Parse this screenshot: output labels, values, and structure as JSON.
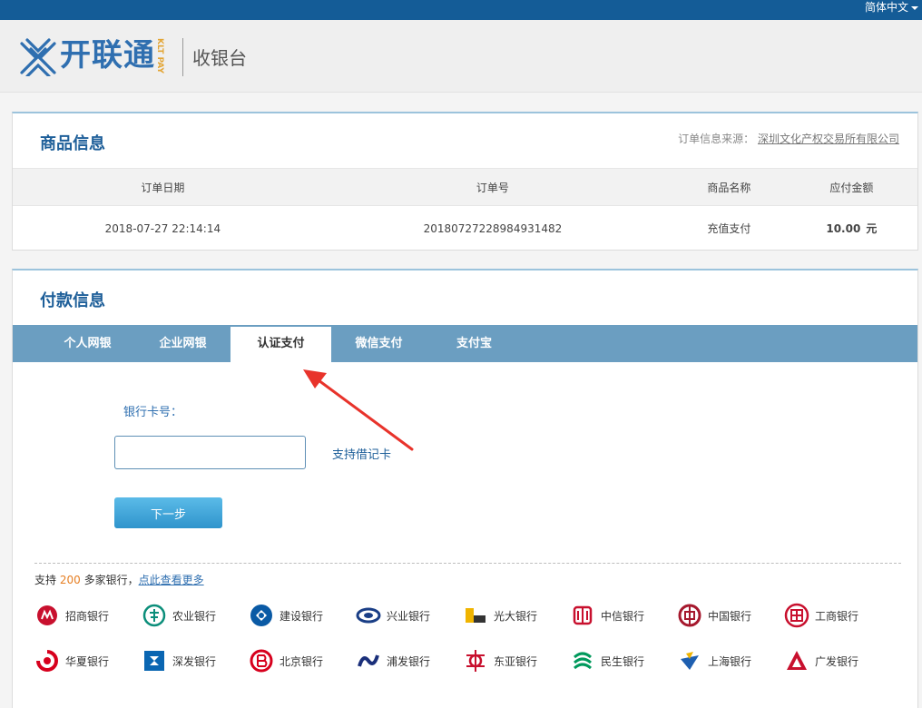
{
  "topbar": {
    "language": "简体中文"
  },
  "header": {
    "logo_text": "开联通",
    "logo_sub": "KLT PAY",
    "title": "收银台"
  },
  "goods": {
    "title": "商品信息",
    "source_label": "订单信息来源：",
    "source_name": "深圳文化产权交易所有限公司",
    "columns": [
      "订单日期",
      "订单号",
      "商品名称",
      "应付金额"
    ],
    "row": {
      "date": "2018-07-27 22:14:14",
      "order_no": "20180727228984931482",
      "product": "充值支付",
      "amount": "10.00",
      "unit": "元"
    }
  },
  "payment": {
    "title": "付款信息",
    "tabs": [
      "个人网银",
      "企业网银",
      "认证支付",
      "微信支付",
      "支付宝"
    ],
    "active_tab": "认证支付",
    "card_label": "银行卡号：",
    "card_value": "",
    "support_text": "支持借记卡",
    "next_button": "下一步",
    "bank_note_prefix": "支持",
    "bank_count": "200",
    "bank_note_suffix": "多家银行，",
    "bank_note_link": "点此查看更多",
    "banks": [
      {
        "name": "招商银行",
        "icon": "cmb-icon",
        "color": "#c8102e"
      },
      {
        "name": "农业银行",
        "icon": "abc-icon",
        "color": "#0b8e7a"
      },
      {
        "name": "建设银行",
        "icon": "ccb-icon",
        "color": "#0a5aa5"
      },
      {
        "name": "兴业银行",
        "icon": "cib-icon",
        "color": "#1a3e86"
      },
      {
        "name": "光大银行",
        "icon": "ceb-icon",
        "color": "#f0b400"
      },
      {
        "name": "中信银行",
        "icon": "citic-icon",
        "color": "#c8102e"
      },
      {
        "name": "中国银行",
        "icon": "boc-icon",
        "color": "#a6192e"
      },
      {
        "name": "工商银行",
        "icon": "icbc-icon",
        "color": "#c8102e"
      },
      {
        "name": "华夏银行",
        "icon": "hxb-icon",
        "color": "#d7001d"
      },
      {
        "name": "深发银行",
        "icon": "sdb-icon",
        "color": "#0a66b2"
      },
      {
        "name": "北京银行",
        "icon": "bob-icon",
        "color": "#d7001d"
      },
      {
        "name": "浦发银行",
        "icon": "spdb-icon",
        "color": "#1a2f7a"
      },
      {
        "name": "东亚银行",
        "icon": "bea-icon",
        "color": "#c8102e"
      },
      {
        "name": "民生银行",
        "icon": "cmbc-icon",
        "color": "#00995c"
      },
      {
        "name": "上海银行",
        "icon": "bosh-icon",
        "color": "#1e5fb0"
      },
      {
        "name": "广发银行",
        "icon": "cgb-icon",
        "color": "#c8102e"
      }
    ]
  },
  "colors": {
    "topbar": "#145c97",
    "tab_bar": "#6b9ec1",
    "accent": "#e67e22",
    "title": "#1e5f99"
  }
}
